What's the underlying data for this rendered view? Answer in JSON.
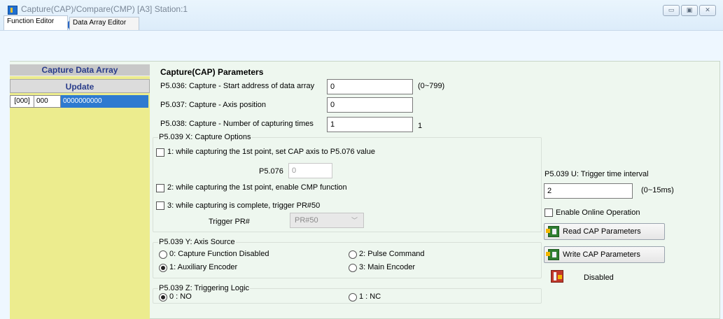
{
  "window": {
    "title": "Capture(CAP)/Compare(CMP) [A3] Station:1",
    "controls": [
      "▭",
      "▣",
      "✕"
    ],
    "toolbar_icons": [
      "save-icon",
      "open-folder-icon",
      "communication-icon",
      "help-icon",
      "lock-icon"
    ]
  },
  "tabs": [
    {
      "label": "Function Editor",
      "active": true
    },
    {
      "label": "Data Array Editor",
      "active": false
    }
  ],
  "capture_data_array": {
    "header": "Capture Data Array",
    "update_label": "Update",
    "rows": [
      {
        "index": "[000]",
        "addr": "000",
        "value": "0000000000"
      }
    ]
  },
  "cap_params": {
    "section_title": "Capture(CAP) Parameters",
    "p5036": {
      "label": "P5.036: Capture - Start address of data array",
      "value": "0",
      "range": "(0~799)"
    },
    "p5037": {
      "label": "P5.037: Capture - Axis position",
      "value": "0"
    },
    "p5038": {
      "label": "P5.038: Capture - Number of capturing times",
      "value": "1",
      "suffix": "1"
    }
  },
  "capture_options": {
    "title": "P5.039 X: Capture Options",
    "opt1": {
      "label": "1: while capturing the 1st point, set CAP axis to P5.076 value",
      "checked": false
    },
    "p5076": {
      "label": "P5.076",
      "value": "0"
    },
    "opt2": {
      "label": "2: while capturing the 1st point, enable CMP function",
      "checked": false
    },
    "opt3": {
      "label": "3: while capturing is complete, trigger PR#50",
      "checked": false
    },
    "trigger_pr": {
      "label": "Trigger PR#",
      "selected": "PR#50"
    }
  },
  "axis_source": {
    "title": "P5.039 Y: Axis Source",
    "options": [
      {
        "label": "0: Capture Function Disabled",
        "selected": false
      },
      {
        "label": "2: Pulse Command",
        "selected": false
      },
      {
        "label": "1: Auxiliary Encoder",
        "selected": true
      },
      {
        "label": "3: Main Encoder",
        "selected": false
      }
    ]
  },
  "triggering_logic": {
    "title": "P5.039 Z: Triggering Logic",
    "options": [
      {
        "label": "0 : NO",
        "selected": true
      },
      {
        "label": "1 : NC",
        "selected": false
      }
    ]
  },
  "right_panel": {
    "trigger_interval_label": "P5.039 U: Trigger time interval",
    "trigger_interval_value": "2",
    "trigger_interval_range": "(0~15ms)",
    "online_label": "Enable Online Operation",
    "read_label": "Read CAP Parameters",
    "write_label": "Write CAP Parameters",
    "status_label": "Disabled"
  }
}
